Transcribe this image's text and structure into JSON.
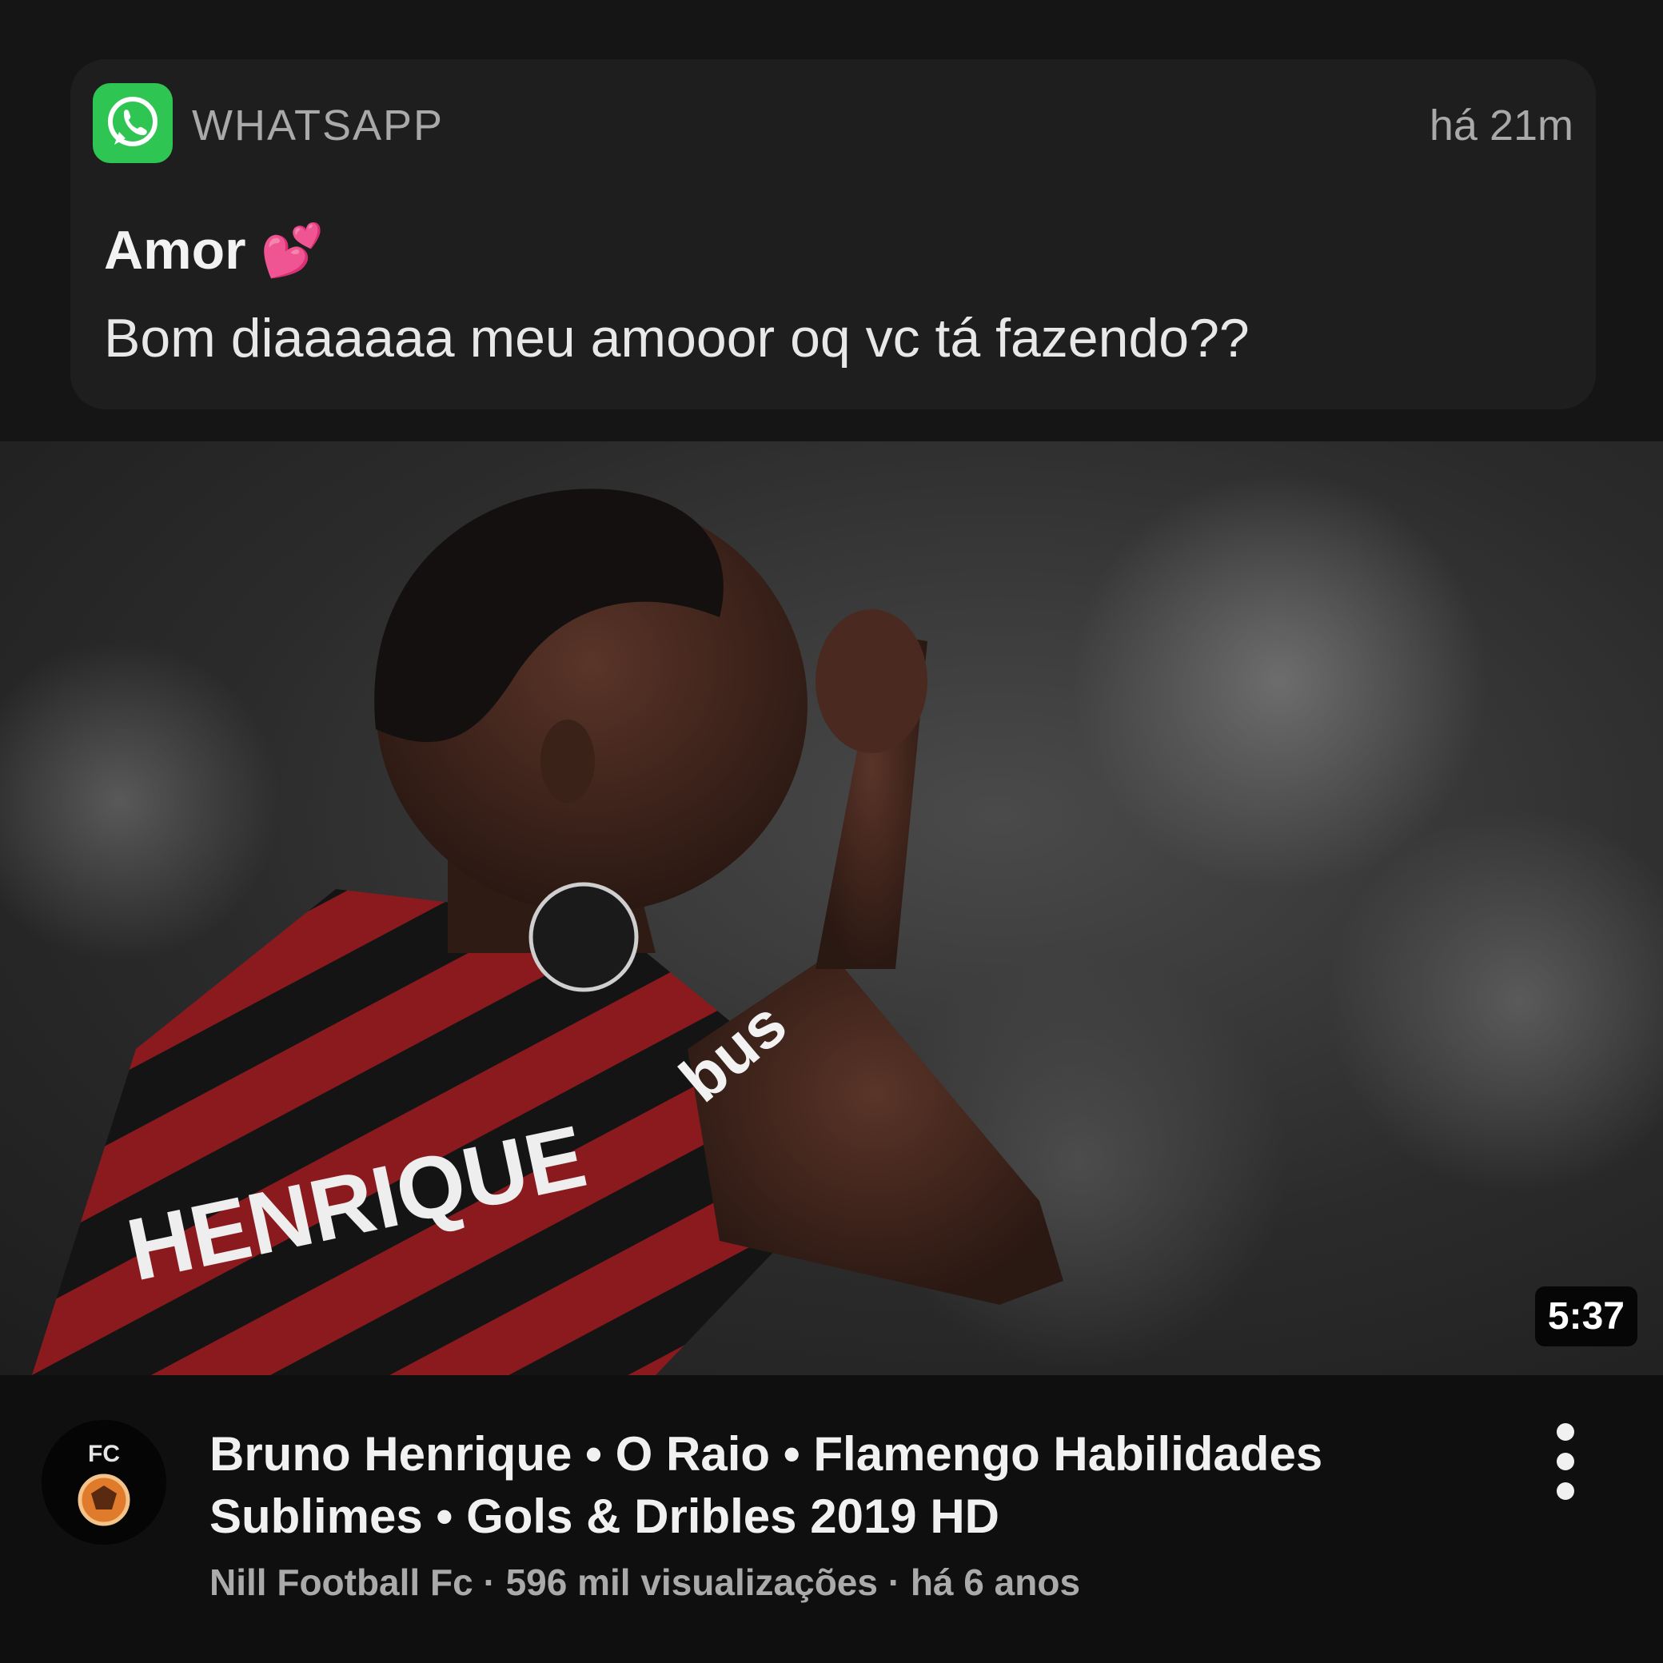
{
  "notification": {
    "app_name": "WHATSAPP",
    "time": "há 21m",
    "sender": "Amor",
    "sender_emoji": "💕",
    "message": "Bom diaaaaaa meu amooor oq vc tá fazendo??",
    "icon": "whatsapp-icon"
  },
  "video": {
    "duration": "5:37",
    "jersey_text": "HENRIQUE",
    "sponsor_text": "bus",
    "title": "Bruno Henrique • O Raio • Flamengo Habilidades Sublimes • Gols & Dribles 2019 HD",
    "channel": "Nill Football Fc",
    "views": "596 mil visualizações",
    "age": "há 6 anos",
    "meta_separator": " · ",
    "avatar_text": "FC"
  },
  "colors": {
    "whatsapp_green": "#2fc553",
    "jersey_red": "#8b1a1f",
    "jersey_black": "#141414",
    "background": "#0f0f0f"
  }
}
